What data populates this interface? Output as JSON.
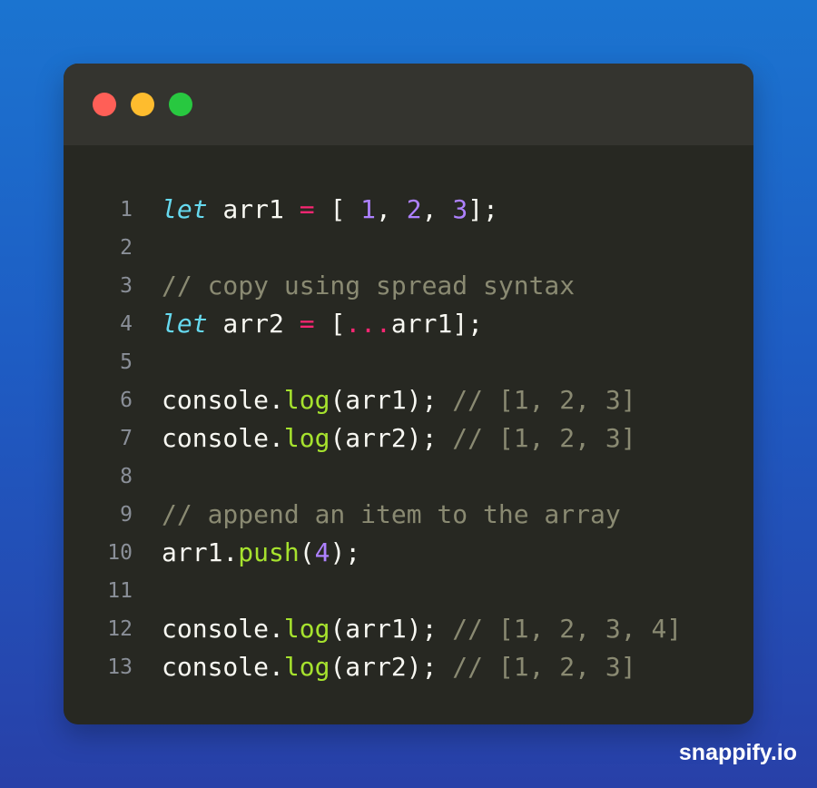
{
  "window": {
    "controls": [
      {
        "name": "close-control",
        "color": "#ff5f57"
      },
      {
        "name": "minimize-control",
        "color": "#febc2e"
      },
      {
        "name": "maximize-control",
        "color": "#28c840"
      }
    ]
  },
  "colors": {
    "keyword": "#66d9ef",
    "operator": "#f92672",
    "number": "#ae81ff",
    "function": "#a6e22e",
    "comment": "#8a8a72",
    "plain": "#f8f8f2"
  },
  "code": {
    "lines": [
      {
        "number": "1",
        "tokens": [
          {
            "text": "let",
            "type": "keyword"
          },
          {
            "text": " arr1 ",
            "type": "plain"
          },
          {
            "text": "=",
            "type": "operator"
          },
          {
            "text": " [ ",
            "type": "plain"
          },
          {
            "text": "1",
            "type": "number"
          },
          {
            "text": ", ",
            "type": "plain"
          },
          {
            "text": "2",
            "type": "number"
          },
          {
            "text": ", ",
            "type": "plain"
          },
          {
            "text": "3",
            "type": "number"
          },
          {
            "text": "];",
            "type": "plain"
          }
        ]
      },
      {
        "number": "2",
        "tokens": []
      },
      {
        "number": "3",
        "tokens": [
          {
            "text": "// copy using spread syntax",
            "type": "comment"
          }
        ]
      },
      {
        "number": "4",
        "tokens": [
          {
            "text": "let",
            "type": "keyword"
          },
          {
            "text": " arr2 ",
            "type": "plain"
          },
          {
            "text": "=",
            "type": "operator"
          },
          {
            "text": " [",
            "type": "plain"
          },
          {
            "text": "...",
            "type": "operator"
          },
          {
            "text": "arr1];",
            "type": "plain"
          }
        ]
      },
      {
        "number": "5",
        "tokens": []
      },
      {
        "number": "6",
        "tokens": [
          {
            "text": "console.",
            "type": "plain"
          },
          {
            "text": "log",
            "type": "function"
          },
          {
            "text": "(arr1); ",
            "type": "plain"
          },
          {
            "text": "// [1, 2, 3]",
            "type": "comment"
          }
        ]
      },
      {
        "number": "7",
        "tokens": [
          {
            "text": "console.",
            "type": "plain"
          },
          {
            "text": "log",
            "type": "function"
          },
          {
            "text": "(arr2); ",
            "type": "plain"
          },
          {
            "text": "// [1, 2, 3]",
            "type": "comment"
          }
        ]
      },
      {
        "number": "8",
        "tokens": []
      },
      {
        "number": "9",
        "tokens": [
          {
            "text": "// append an item to the array",
            "type": "comment"
          }
        ]
      },
      {
        "number": "10",
        "tokens": [
          {
            "text": "arr1.",
            "type": "plain"
          },
          {
            "text": "push",
            "type": "function"
          },
          {
            "text": "(",
            "type": "plain"
          },
          {
            "text": "4",
            "type": "number"
          },
          {
            "text": ");",
            "type": "plain"
          }
        ]
      },
      {
        "number": "11",
        "tokens": []
      },
      {
        "number": "12",
        "tokens": [
          {
            "text": "console.",
            "type": "plain"
          },
          {
            "text": "log",
            "type": "function"
          },
          {
            "text": "(arr1); ",
            "type": "plain"
          },
          {
            "text": "// [1, 2, 3, 4]",
            "type": "comment"
          }
        ]
      },
      {
        "number": "13",
        "tokens": [
          {
            "text": "console.",
            "type": "plain"
          },
          {
            "text": "log",
            "type": "function"
          },
          {
            "text": "(arr2); ",
            "type": "plain"
          },
          {
            "text": "// [1, 2, 3]",
            "type": "comment"
          }
        ]
      }
    ]
  },
  "watermark": {
    "text": "snappify.io"
  }
}
